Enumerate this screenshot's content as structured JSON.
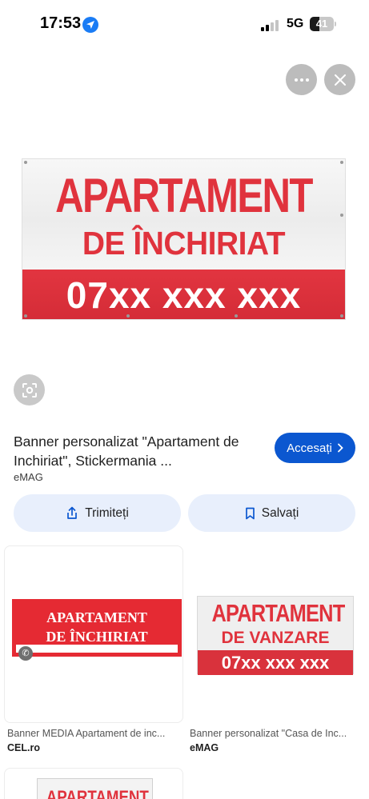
{
  "status_bar": {
    "time": "17:53",
    "network": "5G",
    "battery": "41",
    "battery_level": 0.41
  },
  "top_controls": {
    "more_icon": "more-horizontal-icon",
    "close_icon": "close-icon"
  },
  "hero_image": {
    "line1": "APARTAMENT",
    "line2": "DE ÎNCHIRIAT",
    "phone": "07xx xxx xxx",
    "colors": {
      "red": "#e0333d",
      "white": "#f2f2f2"
    }
  },
  "lens_icon": "lens-search-icon",
  "result": {
    "title": "Banner personalizat \"Apartament de Inchiriat\", Stickermania ...",
    "source": "eMAG",
    "visit_label": "Accesați"
  },
  "actions": {
    "share_label": "Trimiteți",
    "save_label": "Salvați"
  },
  "related": [
    {
      "line1": "APARTAMENT",
      "line2": "DE ÎNCHIRIAT",
      "caption": "Banner MEDIA Apartament de inc...",
      "source": "CEL.ro"
    },
    {
      "line1": "APARTAMENT",
      "line2": "DE VANZARE",
      "phone": "07xx xxx xxx",
      "caption": "Banner personalizat \"Casa de Inc...",
      "source": "eMAG"
    },
    {
      "line1": "APARTAMENT"
    }
  ],
  "colors": {
    "accent": "#0b57d0",
    "action_bg": "#e8effc",
    "banner_red": "#e0333d"
  }
}
